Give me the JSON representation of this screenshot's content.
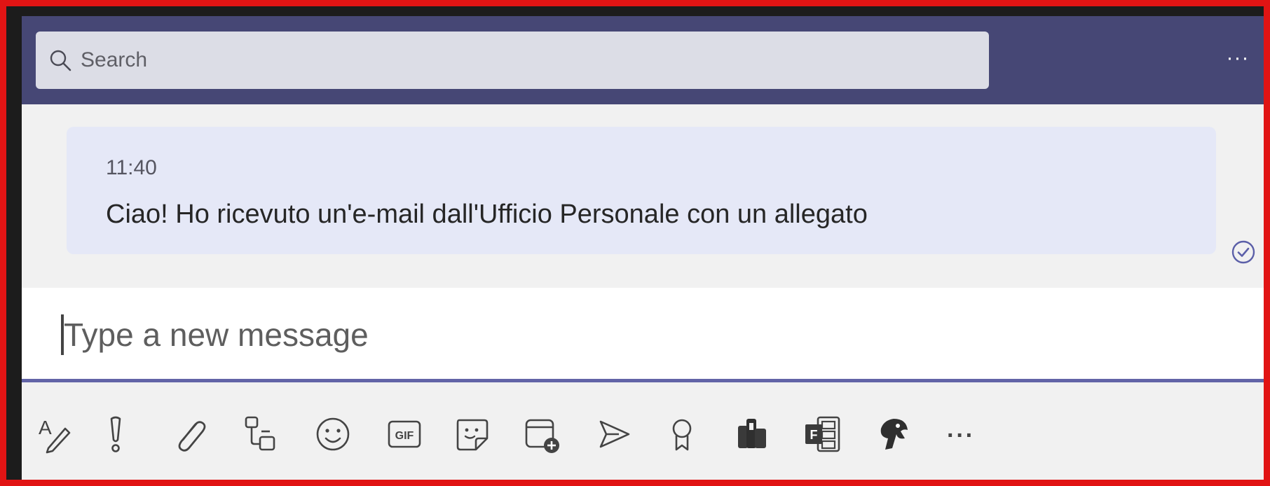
{
  "search": {
    "placeholder": "Search"
  },
  "header": {
    "more_label": "···"
  },
  "message": {
    "time": "11:40",
    "text": "Ciao! Ho ricevuto un'e-mail dall'Ufficio Personale con un allegato",
    "status_icon": "read-receipt-icon"
  },
  "compose": {
    "placeholder": "Type a new message"
  },
  "toolbar": {
    "items": [
      {
        "icon": "format-icon"
      },
      {
        "icon": "important-icon"
      },
      {
        "icon": "attach-icon"
      },
      {
        "icon": "loop-component-icon"
      },
      {
        "icon": "emoji-icon"
      },
      {
        "icon": "gif-icon",
        "label": "GIF"
      },
      {
        "icon": "sticker-icon"
      },
      {
        "icon": "schedule-meeting-icon"
      },
      {
        "icon": "stream-icon"
      },
      {
        "icon": "praise-icon"
      },
      {
        "icon": "app-icon"
      },
      {
        "icon": "forms-icon"
      },
      {
        "icon": "app-parrot-icon"
      },
      {
        "icon": "more-options-icon",
        "label": "···"
      }
    ]
  },
  "colors": {
    "header": "#464775",
    "accent": "#6264a7",
    "bubble": "#e5e8f7",
    "frame": "#e11414"
  }
}
